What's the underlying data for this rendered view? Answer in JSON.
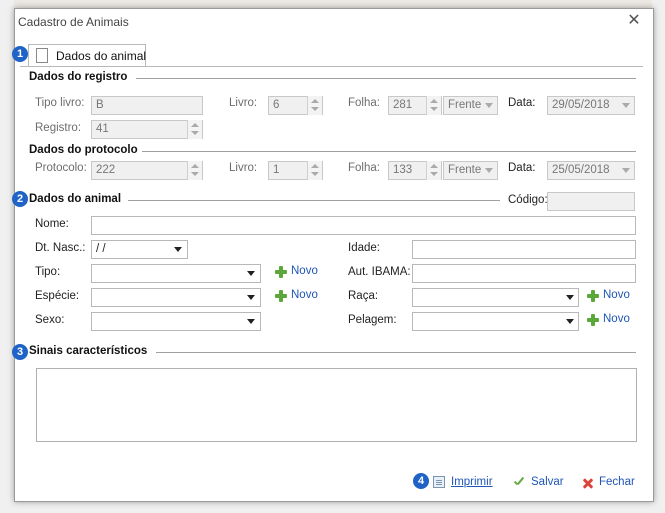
{
  "window": {
    "title": "Cadastro de Animais"
  },
  "tab": {
    "label": "Dados do animal"
  },
  "badges": [
    "1",
    "2",
    "3",
    "4"
  ],
  "registro": {
    "title": "Dados do registro",
    "tipo_livro_label": "Tipo livro:",
    "tipo_livro_value": "B",
    "livro_label": "Livro:",
    "livro_value": "6",
    "folha_label": "Folha:",
    "folha_value": "281",
    "folha_side": "Frente",
    "data_label": "Data:",
    "data_value": "29/05/2018",
    "registro_label": "Registro:",
    "registro_value": "41"
  },
  "protocolo": {
    "title": "Dados do protocolo",
    "protocolo_label": "Protocolo:",
    "protocolo_value": "222",
    "livro_label": "Livro:",
    "livro_value": "1",
    "folha_label": "Folha:",
    "folha_value": "133",
    "folha_side": "Frente",
    "data_label": "Data:",
    "data_value": "25/05/2018"
  },
  "animal": {
    "title": "Dados do animal",
    "codigo_label": "Código:",
    "codigo_value": "",
    "nome_label": "Nome:",
    "nome_value": "",
    "dt_nasc_label": "Dt. Nasc.:",
    "dt_nasc_value": " /  /",
    "idade_label": "Idade:",
    "idade_value": "",
    "tipo_label": "Tipo:",
    "tipo_value": "",
    "aut_ibama_label": "Aut. IBAMA:",
    "aut_ibama_value": "",
    "especie_label": "Espécie:",
    "especie_value": "",
    "raca_label": "Raça:",
    "raca_value": "",
    "sexo_label": "Sexo:",
    "sexo_value": "",
    "pelagem_label": "Pelagem:",
    "pelagem_value": "",
    "novo_label": "Novo"
  },
  "sinais": {
    "title": "Sinais característicos",
    "value": ""
  },
  "footer": {
    "imprimir": "Imprimir",
    "salvar": "Salvar",
    "fechar": "Fechar"
  },
  "colors": {
    "accent": "#1f63c6",
    "link": "#1f55b5",
    "plus": "#5aa83a",
    "close": "#d9453b"
  }
}
